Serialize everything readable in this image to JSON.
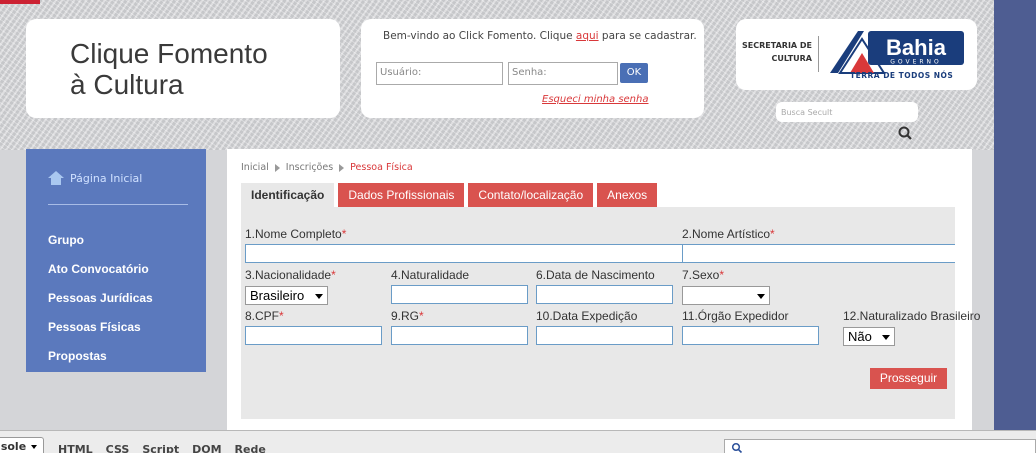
{
  "header": {
    "logo_text": "Clique Fomento\nà Cultura",
    "welcome_prefix": "Bem-vindo ao Click Fomento. Clique ",
    "welcome_link": "aqui",
    "welcome_suffix": " para se cadastrar.",
    "username_placeholder": "Usuário:",
    "password_placeholder": "Senha:",
    "ok_label": "OK",
    "forgot_label": "Esqueci minha senha",
    "secretaria": "SECRETARIA DE\nCULTURA",
    "bahia_name": "Bahia",
    "bahia_sub": "GOVERNO",
    "bahia_tagline": "TERRA DE TODOS NÓS",
    "search_placeholder": "Busca Secult"
  },
  "sidebar": {
    "home": "Página Inicial",
    "items": [
      {
        "label": "Grupo"
      },
      {
        "label": "Ato Convocatório"
      },
      {
        "label": "Pessoas Jurídicas"
      },
      {
        "label": "Pessoas Físicas"
      },
      {
        "label": "Propostas"
      }
    ]
  },
  "breadcrumb": [
    "Inicial",
    "Inscrições",
    "Pessoa Física"
  ],
  "tabs": [
    {
      "label": "Identificação",
      "active": true
    },
    {
      "label": "Dados Profissionais",
      "active": false
    },
    {
      "label": "Contato/localização",
      "active": false
    },
    {
      "label": "Anexos",
      "active": false
    }
  ],
  "form": {
    "nome_completo": "1.Nome Completo",
    "nome_artistico": "2.Nome Artístico",
    "nacionalidade": "3.Nacionalidade",
    "nacionalidade_value": "Brasileiro",
    "naturalidade": "4.Naturalidade",
    "nascimento": "6.Data de Nascimento",
    "sexo": "7.Sexo",
    "cpf": "8.CPF",
    "rg": "9.RG",
    "data_expedicao": "10.Data Expedição",
    "orgao_expedidor": "11.Órgão Expedidor",
    "naturalizado": "12.Naturalizado Brasileiro",
    "naturalizado_value": "Não",
    "required_mark": "*",
    "proceed_label": "Prosseguir"
  },
  "devtools": {
    "console_label": "nsole",
    "tabs": [
      "HTML",
      "CSS",
      "Script",
      "DOM",
      "Rede"
    ]
  },
  "colors": {
    "accent_red": "#d9534f",
    "sidebar_blue": "#5b79bd",
    "link_red": "#d9383a"
  }
}
